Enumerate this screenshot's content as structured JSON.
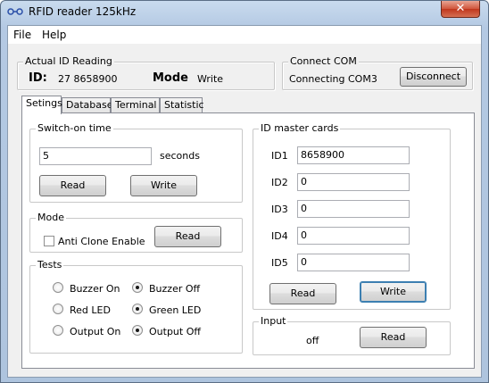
{
  "window": {
    "title": "RFID reader 125kHz",
    "close_label": "✕"
  },
  "menu": {
    "file": "File",
    "help": "Help"
  },
  "actual_id": {
    "group_title": "Actual ID Reading",
    "id_label": "ID:",
    "id_value": "27 8658900",
    "mode_label": "Mode",
    "mode_value": "Write"
  },
  "connect": {
    "group_title": "Connect COM",
    "status": "Connecting COM3",
    "button": "Disconnect"
  },
  "tabs": [
    "Setings",
    "Database",
    "Terminal",
    "Statistic"
  ],
  "switch_on": {
    "group_title": "Switch-on time",
    "value": "5",
    "unit": "seconds",
    "read": "Read",
    "write": "Write"
  },
  "mode": {
    "group_title": "Mode",
    "checkbox_label": "Anti Clone Enable",
    "checked": false,
    "read": "Read"
  },
  "tests": {
    "group_title": "Tests",
    "options": [
      {
        "label": "Buzzer On",
        "selected": false
      },
      {
        "label": "Buzzer Off",
        "selected": true
      },
      {
        "label": "Red LED",
        "selected": false
      },
      {
        "label": "Green LED",
        "selected": true
      },
      {
        "label": "Output On",
        "selected": false
      },
      {
        "label": "Output Off",
        "selected": true
      }
    ]
  },
  "master_cards": {
    "group_title": "ID master cards",
    "ids": [
      {
        "label": "ID1",
        "value": "8658900"
      },
      {
        "label": "ID2",
        "value": "0"
      },
      {
        "label": "ID3",
        "value": "0"
      },
      {
        "label": "ID4",
        "value": "0"
      },
      {
        "label": "ID5",
        "value": "0"
      }
    ],
    "read": "Read",
    "write": "Write"
  },
  "input": {
    "group_title": "Input",
    "state": "off",
    "read": "Read"
  }
}
